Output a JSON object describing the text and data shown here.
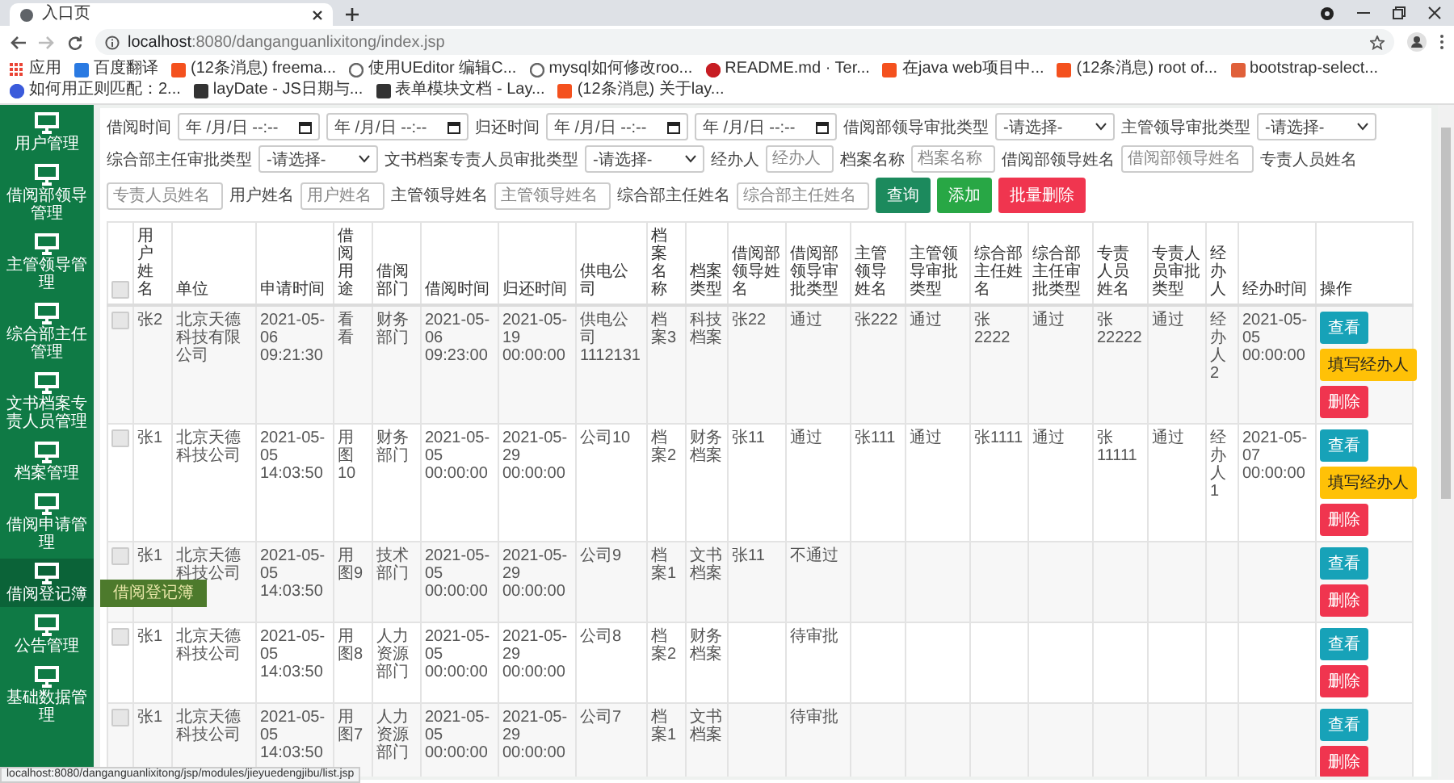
{
  "browser": {
    "tab_title": "入口页",
    "url_host": "localhost",
    "url_path": ":8080/danganguanlixitong/index.jsp",
    "bookmarks": [
      {
        "label": "应用",
        "kind": "apps"
      },
      {
        "label": "百度翻译",
        "kind": "translate"
      },
      {
        "label": "(12条消息) freema...",
        "kind": "csdn"
      },
      {
        "label": "使用UEditor 编辑C...",
        "kind": "swirl"
      },
      {
        "label": "mysql如何修改roo...",
        "kind": "swirl"
      },
      {
        "label": "README.md · Ter...",
        "kind": "gitee"
      },
      {
        "label": "在java web项目中...",
        "kind": "csdn"
      },
      {
        "label": "(12条消息) root of...",
        "kind": "csdn"
      },
      {
        "label": "bootstrap-select...",
        "kind": "square"
      },
      {
        "label": "如何用正则匹配：2...",
        "kind": "paw"
      },
      {
        "label": "layDate - JS日期与...",
        "kind": "dark"
      },
      {
        "label": "表单模块文档 - Lay...",
        "kind": "dark"
      },
      {
        "label": "(12条消息) 关于lay...",
        "kind": "csdn"
      }
    ],
    "status_url": "localhost:8080/danganguanlixitong/jsp/modules/jieyuedengjibu/list.jsp"
  },
  "sidebar": {
    "tooltip": "借阅登记簿",
    "items": [
      {
        "label": "用户管理",
        "hovered": false
      },
      {
        "label": "借阅部领导管理",
        "hovered": false
      },
      {
        "label": "主管领导管理",
        "hovered": false
      },
      {
        "label": "综合部主任管理",
        "hovered": false
      },
      {
        "label": "文书档案专责人员管理",
        "hovered": false
      },
      {
        "label": "档案管理",
        "hovered": false
      },
      {
        "label": "借阅申请管理",
        "hovered": false
      },
      {
        "label": "借阅登记簿",
        "hovered": true
      },
      {
        "label": "公告管理",
        "hovered": false
      },
      {
        "label": "基础数据管理",
        "hovered": false
      }
    ]
  },
  "filters": [
    {
      "kind": "date",
      "label": "借阅时间",
      "placeholder": "年 /月/日 --:--"
    },
    {
      "kind": "date",
      "placeholder": "年 /月/日 --:--"
    },
    {
      "kind": "date",
      "label": "归还时间",
      "placeholder": "年 /月/日 --:--"
    },
    {
      "kind": "date",
      "placeholder": "年 /月/日 --:--"
    },
    {
      "kind": "select",
      "label": "借阅部领导审批类型",
      "value": "-请选择-"
    },
    {
      "kind": "select",
      "label": "主管领导审批类型",
      "value": "-请选择-"
    },
    {
      "kind": "select",
      "label": "综合部主任审批类型",
      "value": "-请选择-"
    },
    {
      "kind": "select",
      "label": "文书档案专责人员审批类型",
      "value": "-请选择-"
    },
    {
      "kind": "text",
      "label": "经办人",
      "placeholder": "经办人"
    },
    {
      "kind": "text",
      "label": "档案名称",
      "placeholder": "档案名称"
    },
    {
      "kind": "text",
      "label": "借阅部领导姓名",
      "placeholder": "借阅部领导姓名"
    },
    {
      "kind": "text",
      "label": "专责人员姓名",
      "placeholder": "专责人员姓名"
    },
    {
      "kind": "text",
      "label": "用户姓名",
      "placeholder": "用户姓名"
    },
    {
      "kind": "text",
      "label": "主管领导姓名",
      "placeholder": "主管领导姓名"
    },
    {
      "kind": "text",
      "label": "综合部主任姓名",
      "placeholder": "综合部主任姓名"
    }
  ],
  "buttons": [
    {
      "label": "查询",
      "kind": "search"
    },
    {
      "label": "添加",
      "kind": "add"
    },
    {
      "label": "批量删除",
      "kind": "delete"
    }
  ],
  "table": {
    "select_all_checked": false,
    "columns": [
      "用户姓名",
      "单位",
      "申请时间",
      "借阅用途",
      "借阅部门",
      "借阅时间",
      "归还时间",
      "供电公司",
      "档案名称",
      "档案类型",
      "借阅部领导姓名",
      "借阅部领导审批类型",
      "主管领导姓名",
      "主管领导审批类型",
      "综合部主任姓名",
      "综合部主任审批类型",
      "专责人员姓名",
      "专责人员审批类型",
      "经办人",
      "经办时间"
    ],
    "actions_header": "操作",
    "rows": [
      {
        "checked": false,
        "cells": [
          "张2",
          "北京天德科技有限公司",
          "2021-05-06 09:21:30",
          "看看",
          "财务部门",
          "2021-05-06 09:23:00",
          "2021-05-19 00:00:00",
          "供电公司1112131",
          "档案3",
          "科技档案",
          "张22",
          "通过",
          "张222",
          "通过",
          "张2222",
          "通过",
          "张22222",
          "通过",
          "经办人2",
          "2021-05-05 00:00:00"
        ],
        "actions": [
          {
            "label": "查看",
            "kind": "view"
          },
          {
            "label": "填写经办人",
            "kind": "fill"
          },
          {
            "label": "删除",
            "kind": "delete"
          }
        ]
      },
      {
        "checked": false,
        "cells": [
          "张1",
          "北京天德科技公司",
          "2021-05-05 14:03:50",
          "用图10",
          "财务部门",
          "2021-05-05 00:00:00",
          "2021-05-29 00:00:00",
          "公司10",
          "档案2",
          "财务档案",
          "张11",
          "通过",
          "张111",
          "通过",
          "张1111",
          "通过",
          "张11111",
          "通过",
          "经办人1",
          "2021-05-07 00:00:00"
        ],
        "actions": [
          {
            "label": "查看",
            "kind": "view"
          },
          {
            "label": "填写经办人",
            "kind": "fill"
          },
          {
            "label": "删除",
            "kind": "delete"
          }
        ]
      },
      {
        "checked": false,
        "cells": [
          "张1",
          "北京天德科技公司",
          "2021-05-05 14:03:50",
          "用图9",
          "技术部门",
          "2021-05-05 00:00:00",
          "2021-05-29 00:00:00",
          "公司9",
          "档案1",
          "文书档案",
          "张11",
          "不通过",
          null,
          null,
          null,
          null,
          null,
          null,
          null,
          null
        ],
        "actions": [
          {
            "label": "查看",
            "kind": "view"
          },
          {
            "label": "删除",
            "kind": "delete"
          }
        ]
      },
      {
        "checked": false,
        "cells": [
          "张1",
          "北京天德科技公司",
          "2021-05-05 14:03:50",
          "用图8",
          "人力资源部门",
          "2021-05-05 00:00:00",
          "2021-05-29 00:00:00",
          "公司8",
          "档案2",
          "财务档案",
          null,
          "待审批",
          null,
          null,
          null,
          null,
          null,
          null,
          null,
          null
        ],
        "actions": [
          {
            "label": "查看",
            "kind": "view"
          },
          {
            "label": "删除",
            "kind": "delete"
          }
        ]
      },
      {
        "checked": false,
        "cells": [
          "张1",
          "北京天德科技公司",
          "2021-05-05 14:03:50",
          "用图7",
          "人力资源部门",
          "2021-05-05 00:00:00",
          "2021-05-29 00:00:00",
          "公司7",
          "档案1",
          "文书档案",
          null,
          "待审批",
          null,
          null,
          null,
          null,
          null,
          null,
          null,
          null
        ],
        "actions": [
          {
            "label": "查看",
            "kind": "view"
          },
          {
            "label": "删除",
            "kind": "delete"
          }
        ]
      }
    ]
  }
}
